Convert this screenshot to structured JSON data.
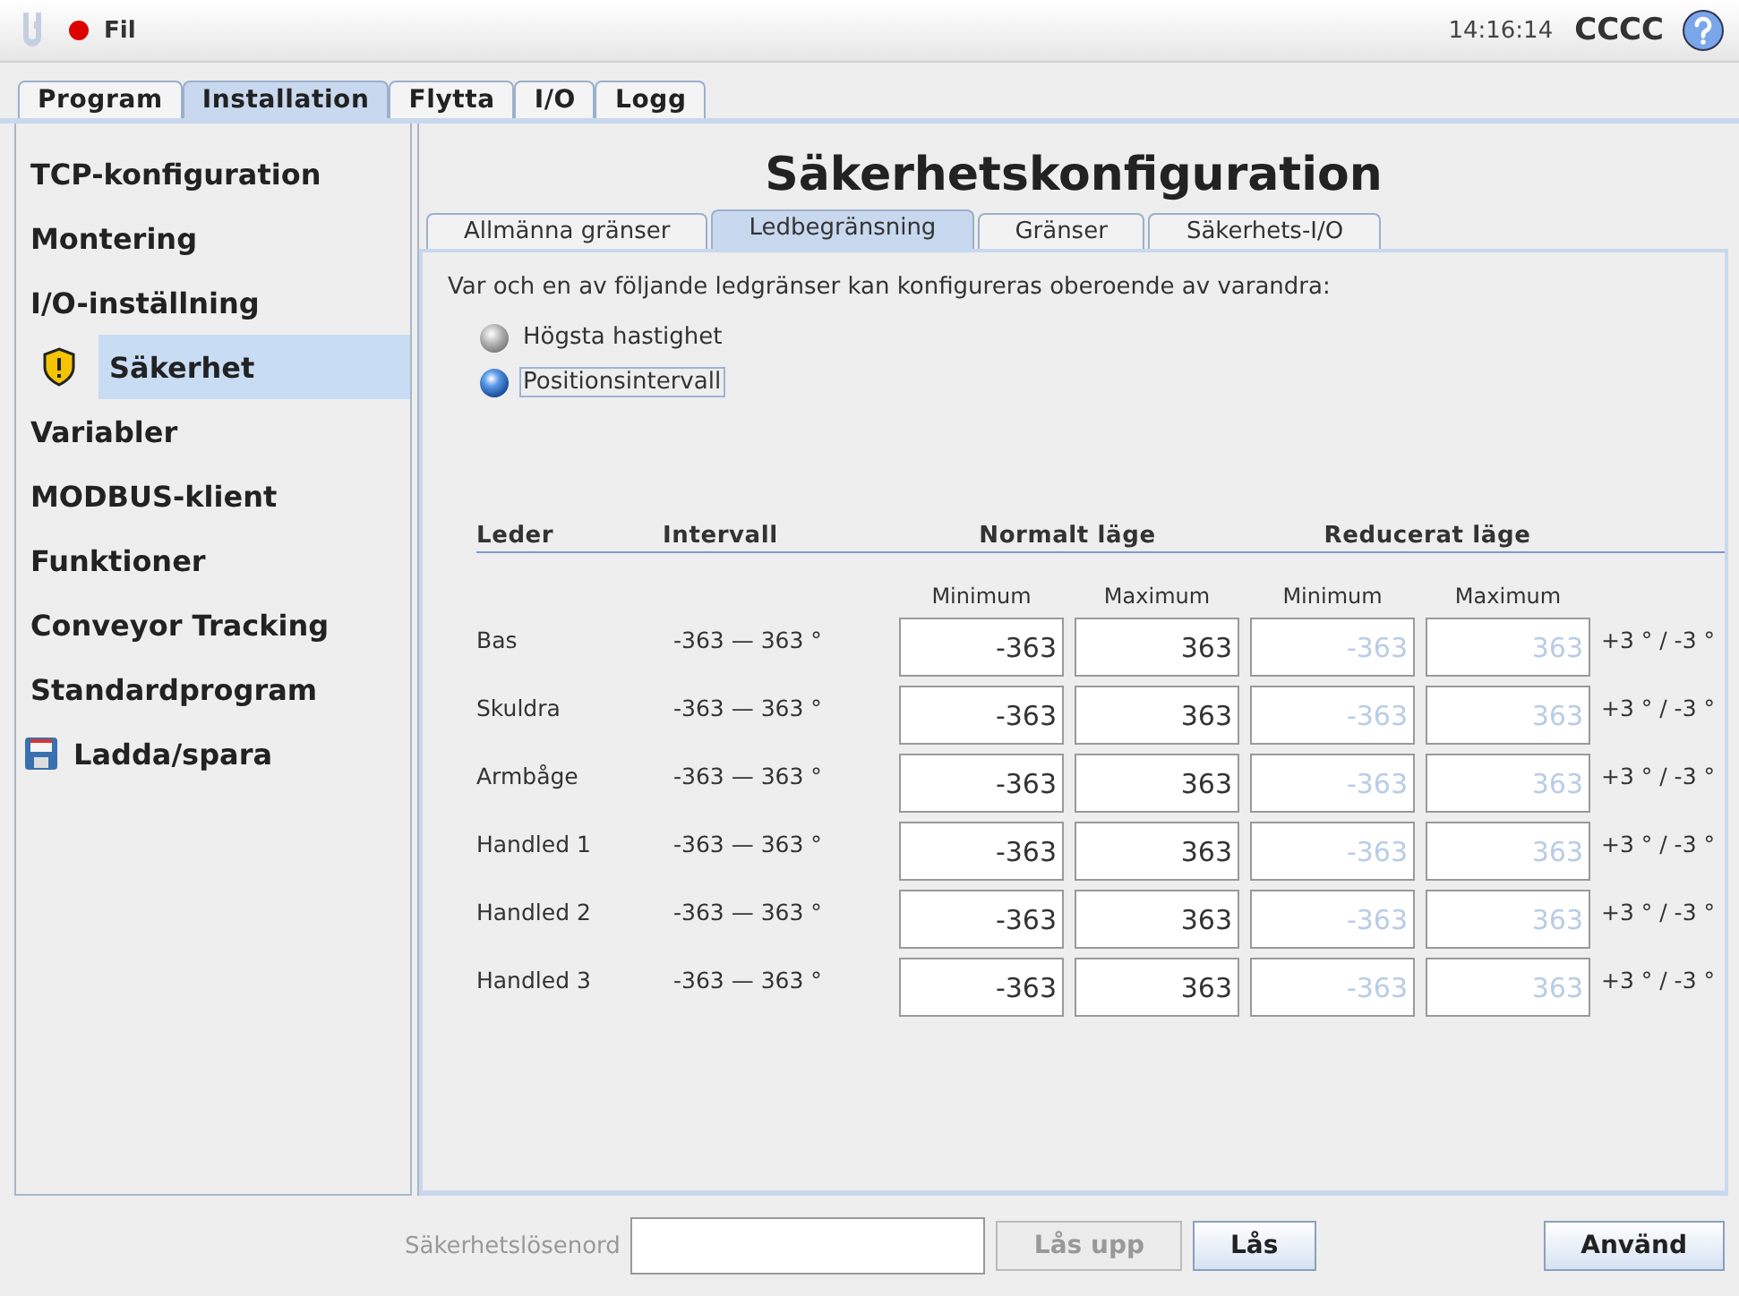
{
  "header": {
    "menu": "Fil",
    "time": "14:16:14",
    "robot_name": "CCCC"
  },
  "tabs": [
    {
      "label": "Program",
      "selected": false
    },
    {
      "label": "Installation",
      "selected": true
    },
    {
      "label": "Flytta",
      "selected": false
    },
    {
      "label": "I/O",
      "selected": false
    },
    {
      "label": "Logg",
      "selected": false
    }
  ],
  "sidebar": {
    "items": [
      {
        "label": "TCP-konfiguration",
        "selected": false,
        "kind": "plain"
      },
      {
        "label": "Montering",
        "selected": false,
        "kind": "plain"
      },
      {
        "label": "I/O-inställning",
        "selected": false,
        "kind": "plain"
      },
      {
        "label": "Säkerhet",
        "selected": true,
        "kind": "shield"
      },
      {
        "label": "Variabler",
        "selected": false,
        "kind": "plain"
      },
      {
        "label": "MODBUS-klient",
        "selected": false,
        "kind": "plain"
      },
      {
        "label": "Funktioner",
        "selected": false,
        "kind": "plain"
      },
      {
        "label": "Conveyor Tracking",
        "selected": false,
        "kind": "plain"
      },
      {
        "label": "Standardprogram",
        "selected": false,
        "kind": "plain"
      },
      {
        "label": "Ladda/spara",
        "selected": false,
        "kind": "disk"
      }
    ]
  },
  "title": "Säkerhetskonfiguration",
  "subtabs": [
    {
      "label": "Allmänna gränser",
      "selected": false
    },
    {
      "label": "Ledbegränsning",
      "selected": true
    },
    {
      "label": "Gränser",
      "selected": false
    },
    {
      "label": "Säkerhets-I/O",
      "selected": false
    }
  ],
  "intro": "Var och en av följande ledgränser kan konfigureras oberoende av varandra:",
  "options": [
    {
      "label": "Högsta hastighet",
      "selected": false,
      "focused": false
    },
    {
      "label": "Positionsintervall",
      "selected": true,
      "focused": true
    }
  ],
  "table": {
    "columns": [
      "Leder",
      "Intervall",
      "Normalt läge",
      "Reducerat läge"
    ],
    "subcolumns": [
      "Minimum",
      "Maximum",
      "Minimum",
      "Maximum"
    ],
    "reduced_disabled": true,
    "rows": [
      {
        "joint": "Bas",
        "range": "-363 — 363 °",
        "normal_min": "-363",
        "normal_max": "363",
        "reduced_min": "-363",
        "reduced_max": "363",
        "tolerance": "+3 ° / -3 °"
      },
      {
        "joint": "Skuldra",
        "range": "-363 — 363 °",
        "normal_min": "-363",
        "normal_max": "363",
        "reduced_min": "-363",
        "reduced_max": "363",
        "tolerance": "+3 ° / -3 °"
      },
      {
        "joint": "Armbåge",
        "range": "-363 — 363 °",
        "normal_min": "-363",
        "normal_max": "363",
        "reduced_min": "-363",
        "reduced_max": "363",
        "tolerance": "+3 ° / -3 °"
      },
      {
        "joint": "Handled 1",
        "range": "-363 — 363 °",
        "normal_min": "-363",
        "normal_max": "363",
        "reduced_min": "-363",
        "reduced_max": "363",
        "tolerance": "+3 ° / -3 °"
      },
      {
        "joint": "Handled 2",
        "range": "-363 — 363 °",
        "normal_min": "-363",
        "normal_max": "363",
        "reduced_min": "-363",
        "reduced_max": "363",
        "tolerance": "+3 ° / -3 °"
      },
      {
        "joint": "Handled 3",
        "range": "-363 — 363 °",
        "normal_min": "-363",
        "normal_max": "363",
        "reduced_min": "-363",
        "reduced_max": "363",
        "tolerance": "+3 ° / -3 °"
      }
    ]
  },
  "footer": {
    "password_label": "Säkerhetslösenord",
    "password_disabled": true,
    "buttons": [
      {
        "label": "Lås upp",
        "disabled": true
      },
      {
        "label": "Lås",
        "disabled": false
      },
      {
        "label": "Använd",
        "disabled": false
      }
    ]
  }
}
